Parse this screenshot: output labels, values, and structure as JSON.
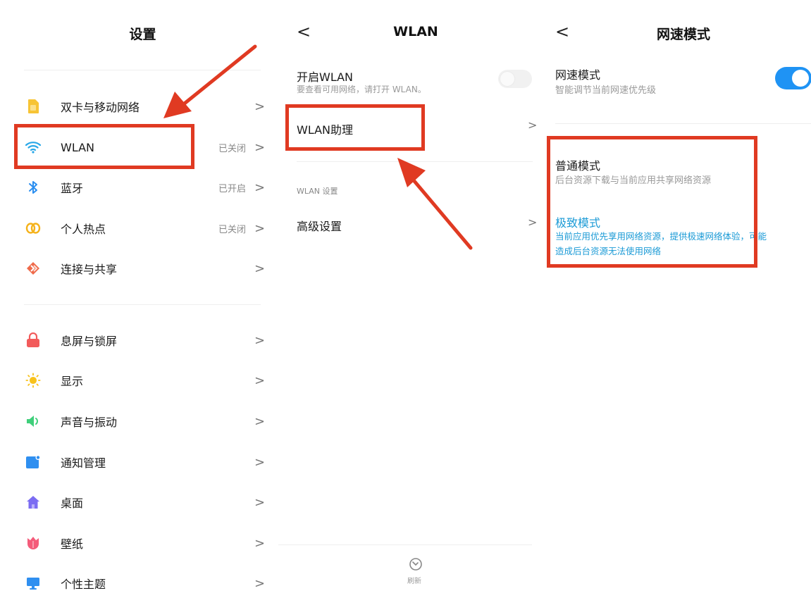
{
  "settings": {
    "title": "设置",
    "items": [
      {
        "label": "双卡与移动网络",
        "status": "",
        "icon": "sim-card-icon",
        "color": "#f7c435"
      },
      {
        "label": "WLAN",
        "status": "已关闭",
        "icon": "wifi-icon",
        "color": "#2aa8e8"
      },
      {
        "label": "蓝牙",
        "status": "已开启",
        "icon": "bluetooth-icon",
        "color": "#2a8ef0"
      },
      {
        "label": "个人热点",
        "status": "已关闭",
        "icon": "hotspot-icon",
        "color": "#f5b21a"
      },
      {
        "label": "连接与共享",
        "status": "",
        "icon": "share-icon",
        "color": "#ef6a4a"
      },
      {
        "label": "息屏与锁屏",
        "status": "",
        "icon": "lock-icon",
        "color": "#f25b5b"
      },
      {
        "label": "显示",
        "status": "",
        "icon": "sun-icon",
        "color": "#f8c21c"
      },
      {
        "label": "声音与振动",
        "status": "",
        "icon": "speaker-icon",
        "color": "#3fcf7a"
      },
      {
        "label": "通知管理",
        "status": "",
        "icon": "notification-icon",
        "color": "#2f8ff0"
      },
      {
        "label": "桌面",
        "status": "",
        "icon": "home-icon",
        "color": "#7b6cf2"
      },
      {
        "label": "壁纸",
        "status": "",
        "icon": "tulip-icon",
        "color": "#f45b7a"
      },
      {
        "label": "个性主题",
        "status": "",
        "icon": "monitor-icon",
        "color": "#2f8ff0"
      }
    ]
  },
  "wlan": {
    "title": "WLAN",
    "open_wlan": {
      "title": "开启WLAN",
      "subtitle": "要查看可用网络，请打开 WLAN。"
    },
    "assistant": "WLAN助理",
    "section_header": "WLAN 设置",
    "advanced": "高级设置",
    "refresh_label": "刷新"
  },
  "speed": {
    "title": "网速模式",
    "main": {
      "title": "网速模式",
      "subtitle": "智能调节当前网速优先级"
    },
    "normal": {
      "title": "普通模式",
      "subtitle": "后台资源下载与当前应用共享网络资源"
    },
    "extreme": {
      "title": "极致模式",
      "subtitle_line1": "当前应用优先享用网络资源，提供极速网络体验，可能",
      "subtitle_line2": "造成后台资源无法使用网络"
    }
  },
  "colors": {
    "annotation": "#e03a22",
    "accent_blue": "#1f93f4",
    "link_blue": "#1a9ad6"
  }
}
